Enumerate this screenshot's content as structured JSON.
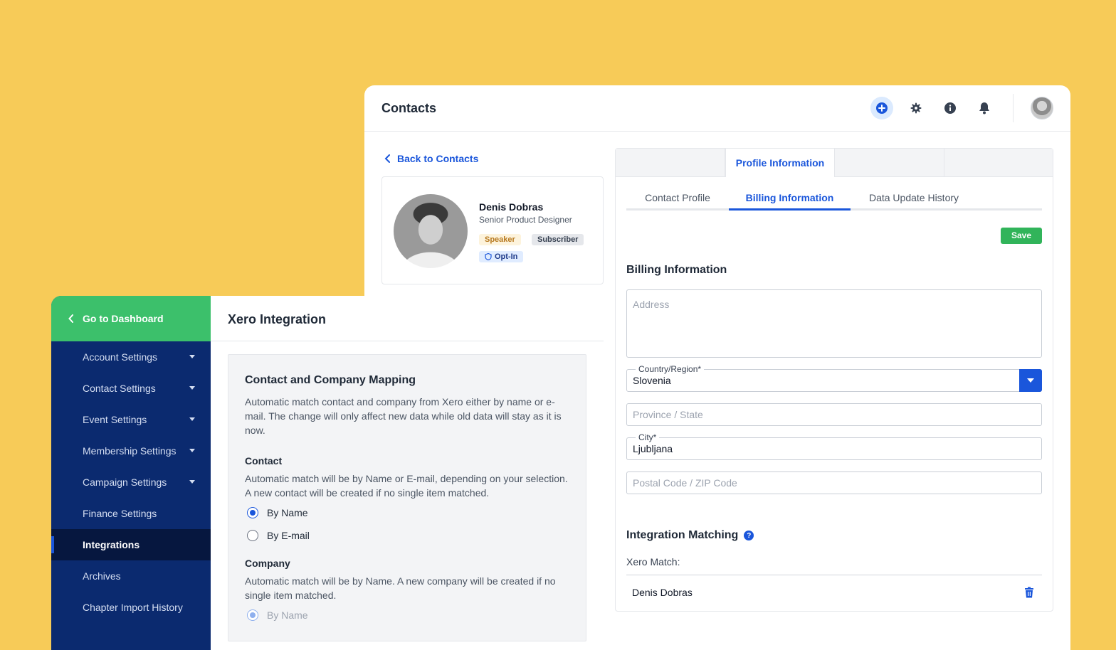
{
  "contacts": {
    "title": "Contacts",
    "header_icons": [
      "plus-circle-icon",
      "gear-icon",
      "info-icon",
      "bell-icon"
    ],
    "back_link": "Back to Contacts",
    "profile": {
      "name": "Denis Dobras",
      "role": "Senior Product Designer",
      "badges": [
        "Speaker",
        "Subscriber"
      ],
      "optin": "Opt-In"
    },
    "top_tabs": [
      "",
      "Profile Information",
      "",
      ""
    ],
    "sub_tabs": [
      "Contact Profile",
      "Billing Information",
      "Data Update History"
    ],
    "save_label": "Save",
    "billing": {
      "title": "Billing Information",
      "address_placeholder": "Address",
      "country_label": "Country/Region*",
      "country_value": "Slovenia",
      "province_placeholder": "Province / State",
      "city_label": "City*",
      "city_value": "Ljubljana",
      "postal_placeholder": "Postal Code / ZIP Code"
    },
    "integration": {
      "title": "Integration Matching",
      "help": "?",
      "xero_match_label": "Xero Match:",
      "match_name": "Denis Dobras"
    }
  },
  "settings": {
    "go_dashboard": "Go to Dashboard",
    "menu": [
      {
        "label": "Account Settings"
      },
      {
        "label": "Contact Settings"
      },
      {
        "label": "Event Settings"
      },
      {
        "label": "Membership Settings"
      },
      {
        "label": "Campaign Settings"
      },
      {
        "label": "Finance Settings"
      },
      {
        "label": "Integrations"
      },
      {
        "label": "Archives"
      },
      {
        "label": "Chapter Import History"
      }
    ],
    "page_title": "Xero Integration",
    "mapping": {
      "title": "Contact and Company Mapping",
      "desc": "Automatic match contact and company from Xero either by name or e-mail. The change will only affect new data while old data will stay as it is now.",
      "contact_title": "Contact",
      "contact_text": "Automatic match will be by Name or E-mail, depending on your selection. A new contact will be created if no single item matched.",
      "contact_options": [
        "By Name",
        "By E-mail"
      ],
      "company_title": "Company",
      "company_text": "Automatic match will be by Name. A new company will be created if no single item matched.",
      "company_option": "By Name"
    }
  },
  "colors": {
    "background": "#F7CB58",
    "brand_blue": "#1A56DB",
    "sidebar": "#0B2A6F",
    "green": "#3CC06B"
  }
}
